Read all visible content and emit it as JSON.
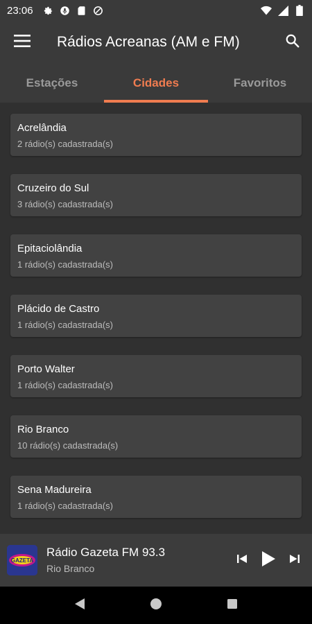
{
  "status_bar": {
    "time": "23:06",
    "left_icons": [
      "settings-icon",
      "mic-icon",
      "sd-card-icon",
      "data-saver-icon"
    ],
    "right_icons": [
      "wifi-icon",
      "signal-icon",
      "battery-icon"
    ]
  },
  "app_bar": {
    "title": "Rádios Acreanas (AM e FM)",
    "menu_icon": "hamburger-menu-icon",
    "search_icon": "search-icon"
  },
  "tabs": [
    {
      "label": "Estações",
      "active": false
    },
    {
      "label": "Cidades",
      "active": true
    },
    {
      "label": "Favoritos",
      "active": false
    }
  ],
  "accent_color": "#f07c50",
  "cities": [
    {
      "name": "Acrelândia",
      "count": "2 rádio(s) cadastrada(s)"
    },
    {
      "name": "Cruzeiro do Sul",
      "count": "3 rádio(s) cadastrada(s)"
    },
    {
      "name": "Epitaciolândia",
      "count": "1 rádio(s) cadastrada(s)"
    },
    {
      "name": "Plácido de Castro",
      "count": "1 rádio(s) cadastrada(s)"
    },
    {
      "name": "Porto Walter",
      "count": "1 rádio(s) cadastrada(s)"
    },
    {
      "name": "Rio Branco",
      "count": "10 rádio(s) cadastrada(s)"
    },
    {
      "name": "Sena Madureira",
      "count": "1 rádio(s) cadastrada(s)"
    }
  ],
  "player": {
    "station": "Rádio Gazeta FM 93.3",
    "city": "Rio Branco",
    "logo_text": "GAZETA",
    "controls": [
      "skip-previous-icon",
      "play-icon",
      "skip-next-icon"
    ]
  },
  "nav_bar": {
    "buttons": [
      "back-icon",
      "home-icon",
      "recents-icon"
    ]
  }
}
